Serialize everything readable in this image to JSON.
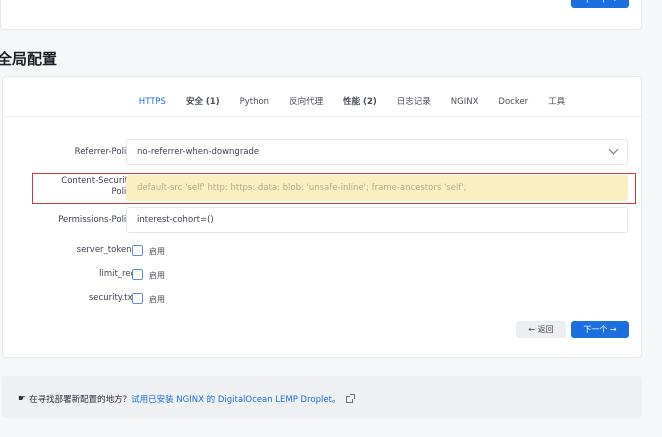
{
  "top": {
    "next_label": "下一个 →"
  },
  "section_title": "全局配置",
  "tabs": [
    {
      "label": "HTTPS",
      "active": true,
      "bold": false
    },
    {
      "label": "安全 (1)",
      "active": false,
      "bold": true
    },
    {
      "label": "Python",
      "active": false,
      "bold": false
    },
    {
      "label": "反向代理",
      "active": false,
      "bold": false
    },
    {
      "label": "性能 (2)",
      "active": false,
      "bold": true
    },
    {
      "label": "日志记录",
      "active": false,
      "bold": false
    },
    {
      "label": "NGINX",
      "active": false,
      "bold": false
    },
    {
      "label": "Docker",
      "active": false,
      "bold": false
    },
    {
      "label": "工具",
      "active": false,
      "bold": false
    }
  ],
  "form": {
    "referrer_policy": {
      "label": "Referrer-Policy",
      "value": "no-referrer-when-downgrade"
    },
    "csp": {
      "label_line1": "Content-Security-",
      "label_line2": "Policy",
      "value": "default-src 'self' http: https: data: blob: 'unsafe-inline'; frame-ancestors 'self';"
    },
    "permissions_policy": {
      "label": "Permissions-Policy",
      "value": "interest-cohort=()"
    },
    "server_tokens": {
      "label": "server_tokens",
      "check_label": "启用"
    },
    "limit_req": {
      "label": "limit_req",
      "check_label": "启用"
    },
    "security_txt": {
      "label": "security.txt",
      "check_label": "启用"
    }
  },
  "buttons": {
    "back": "← 返回",
    "next": "下一个 →"
  },
  "footer": {
    "question": "在寻找部署新配置的地方?",
    "link": "试用已安装 NGINX 的 DigitalOcean LEMP Droplet。"
  },
  "colors": {
    "accent": "#1d6fe0",
    "highlight": "#fbefc2",
    "annotation": "#d23b3b"
  }
}
